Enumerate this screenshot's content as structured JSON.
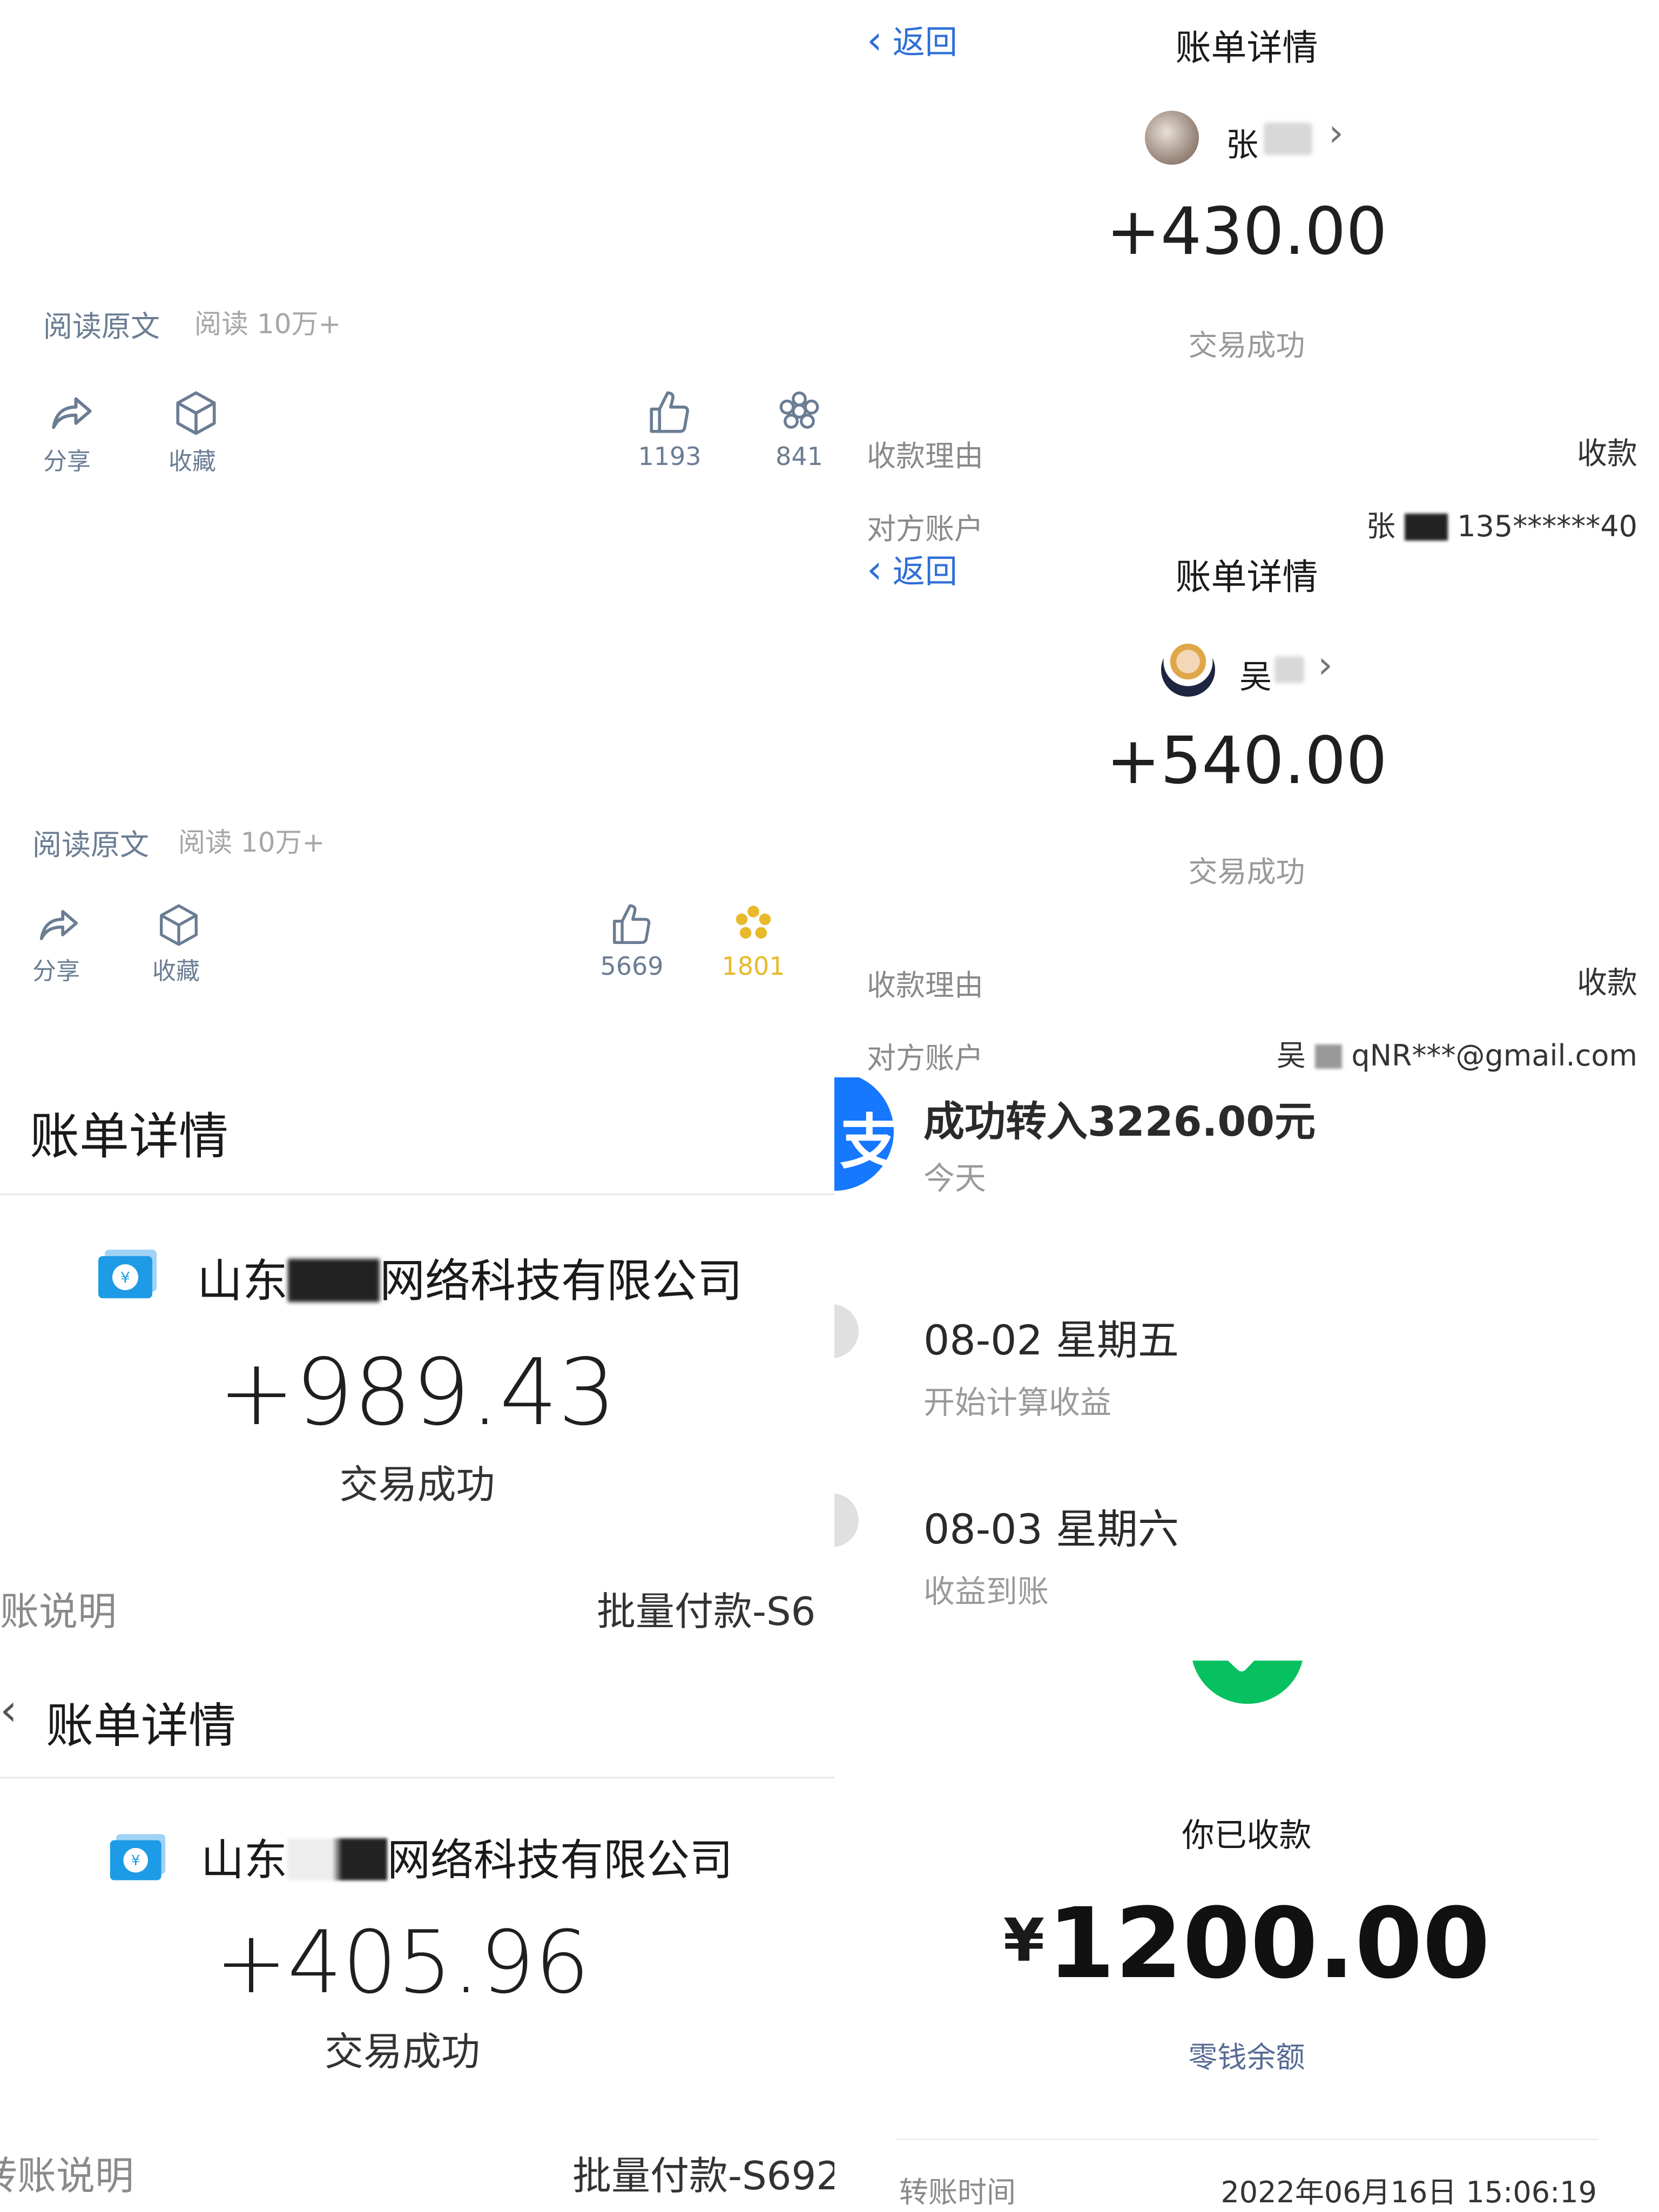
{
  "article1": {
    "read_original": "阅读原文",
    "read_count": "阅读 10万+",
    "share_label": "分享",
    "collect_label": "收藏",
    "like_count": "1193",
    "wow_count": "841"
  },
  "article2": {
    "read_original": "阅读原文",
    "read_count": "阅读 10万+",
    "share_label": "分享",
    "collect_label": "收藏",
    "like_count": "5669",
    "wow_count": "1801"
  },
  "bill1": {
    "title": "账单详情",
    "company_prefix": "山东",
    "company_suffix": "网络科技有限公司",
    "amount": "+989.43",
    "status": "交易成功",
    "note_label": "账说明",
    "note_value": "批量付款-S6"
  },
  "bill2": {
    "title": "账单详情",
    "company_prefix": "山东",
    "company_suffix": "网络科技有限公司",
    "amount": "+405.96",
    "status": "交易成功",
    "note_label": "转账说明",
    "note_value": "批量付款-S692"
  },
  "alipay1": {
    "back": "返回",
    "title": "账单详情",
    "payer_name": "张",
    "amount": "+430.00",
    "status": "交易成功",
    "reason_label": "收款理由",
    "reason_value": "收款",
    "account_label": "对方账户",
    "account_name": "张",
    "account_value": "135******40"
  },
  "alipay2": {
    "back": "返回",
    "title": "账单详情",
    "payer_name": "吴",
    "amount": "+540.00",
    "status": "交易成功",
    "reason_label": "收款理由",
    "reason_value": "收款",
    "account_label": "对方账户",
    "account_name": "吴",
    "account_value": "qNR***@gmail.com"
  },
  "transfer": {
    "headline": "成功转入3226.00元",
    "today": "今天",
    "step1_date": "08-02 星期五",
    "step1_desc": "开始计算收益",
    "step2_date": "08-03 星期六",
    "step2_desc": "收益到账"
  },
  "wechat": {
    "received": "你已收款",
    "currency": "¥",
    "amount": "1200.00",
    "balance_link": "零钱余额",
    "time_label": "转账时间",
    "time_value": "2022年06月16日 15:06:19"
  },
  "colors": {
    "link_blue": "#2f6fd8",
    "alipay_blue": "#1677ff",
    "wechat_green": "#07c160",
    "wow_gold": "#e8b92a"
  }
}
